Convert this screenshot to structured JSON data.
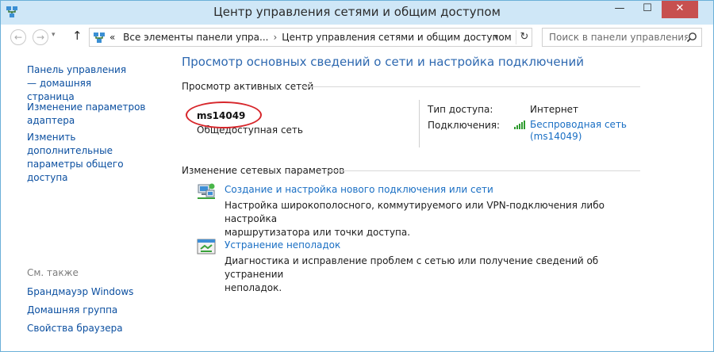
{
  "window": {
    "title": "Центр управления сетями и общим доступом",
    "controls": {
      "minimize": "—",
      "maximize": "☐",
      "close": "✕"
    }
  },
  "navigation": {
    "back": "←",
    "forward": "→",
    "up": "↑",
    "address": {
      "prefix": "«",
      "crumbs": [
        "Все элементы панели упра...",
        "Центр управления сетями и общим доступом"
      ],
      "separator": "›"
    },
    "refresh": "↻",
    "search_placeholder": "Поиск в панели управления"
  },
  "sidebar": {
    "links": [
      {
        "label": "Панель управления — домашняя страница"
      },
      {
        "label": "Изменение параметров адаптера"
      },
      {
        "label": "Изменить дополнительные параметры общего доступа"
      }
    ],
    "see_also_heading": "См. также",
    "see_also": [
      {
        "label": "Брандмауэр Windows"
      },
      {
        "label": "Домашняя группа"
      },
      {
        "label": "Свойства браузера"
      }
    ]
  },
  "main": {
    "title": "Просмотр основных сведений о сети и настройка подключений",
    "active_networks_heading": "Просмотр активных сетей",
    "network": {
      "name": "ms14049",
      "category": "Общедоступная сеть",
      "access_label": "Тип доступа:",
      "access_value": "Интернет",
      "connections_label": "Подключения:",
      "connection_link_line1": "Беспроводная сеть",
      "connection_link_line2": "(ms14049)"
    },
    "change_heading": "Изменение сетевых параметров",
    "tasks": [
      {
        "icon": "network-setup-icon",
        "link": "Создание и настройка нового подключения или сети",
        "desc_line1": "Настройка широкополосного, коммутируемого или VPN-подключения либо настройка",
        "desc_line2": "маршрутизатора или точки доступа."
      },
      {
        "icon": "troubleshoot-icon",
        "link": "Устранение неполадок",
        "desc_line1": "Диагностика и исправление проблем с сетью или получение сведений об устранении",
        "desc_line2": "неполадок."
      }
    ]
  },
  "colors": {
    "title_bar": "#cfe7f7",
    "link": "#1a6fc4",
    "heading": "#2d68b0",
    "close_button": "#c7504f",
    "highlight": "#d7262b"
  }
}
